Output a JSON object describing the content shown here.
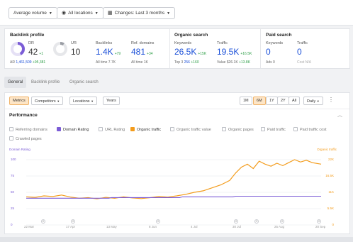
{
  "topbar": {
    "volume": "Average volume",
    "locations": "All locations",
    "changes": "Changes: Last 3 months"
  },
  "backlink": {
    "title": "Backlink profile",
    "dr_label": "DR",
    "dr_value": "42",
    "dr_delta": "+1",
    "ur_label": "UR",
    "ur_value": "10",
    "ar_prefix": "AR",
    "ar_value": "1,461,509",
    "ar_delta": "+95,381",
    "backlinks_label": "Backlinks",
    "backlinks_value": "1.4K",
    "backlinks_delta": "+79",
    "backlinks_sub": "All time 7.7K",
    "refdomains_label": "Ref. domains",
    "refdomains_value": "481",
    "refdomains_delta": "+34",
    "refdomains_sub": "All time 1K"
  },
  "organic": {
    "title": "Organic search",
    "keywords_label": "Keywords",
    "keywords_value": "26.5K",
    "keywords_delta": "+15K",
    "top3_prefix": "Top 3",
    "top3_value": "256",
    "top3_delta": "+160",
    "traffic_label": "Traffic",
    "traffic_value": "19.5K",
    "traffic_delta": "+16.5K",
    "value_prefix": "Value",
    "value_value": "$26.1K",
    "value_delta": "+13.8K"
  },
  "paid": {
    "title": "Paid search",
    "keywords_label": "Keywords",
    "keywords_value": "0",
    "ads_label": "Ads 0",
    "traffic_label": "Traffic",
    "traffic_value": "0",
    "cost_label": "Cost N/A"
  },
  "tabs": [
    "General",
    "Backlink profile",
    "Organic search"
  ],
  "controls": {
    "metrics": "Metrics",
    "competitors": "Competitors",
    "locations": "Locations",
    "years": "Years",
    "ranges": [
      "1M",
      "6M",
      "1Y",
      "2Y",
      "All"
    ],
    "active_range": "6M",
    "interval": "Daily"
  },
  "performance": {
    "title": "Performance",
    "checkboxes": [
      {
        "label": "Referring domains",
        "checked": false
      },
      {
        "label": "Domain Rating",
        "checked": true,
        "color": "#7b5cd6"
      },
      {
        "label": "URL Rating",
        "checked": false
      },
      {
        "label": "Organic traffic",
        "checked": true,
        "color": "#f39c1c"
      },
      {
        "label": "Organic traffic value",
        "checked": false
      },
      {
        "label": "Organic pages",
        "checked": false
      },
      {
        "label": "Paid traffic",
        "checked": false
      },
      {
        "label": "Paid traffic cost",
        "checked": false
      },
      {
        "label": "Crawled pages",
        "checked": false
      }
    ]
  },
  "chart_data": {
    "type": "line",
    "left_axis_title": "Domain Rating",
    "right_axis_title": "Organic traffic",
    "left_ticks": [
      "100",
      "75",
      "50",
      "25",
      "0"
    ],
    "right_ticks": [
      "22K",
      "16.5K",
      "11K",
      "5.5K",
      "0"
    ],
    "x_ticks": [
      "22 Mar",
      "17 Apr",
      "13 May",
      "8 Jun",
      "4 Jul",
      "30 Jul",
      "25 Aug",
      "20 Sep"
    ],
    "markers": [
      "G",
      "G",
      "G",
      "G",
      "G",
      "G",
      "G"
    ],
    "series": [
      {
        "name": "Domain Rating",
        "color": "#7b5cd6",
        "axis": "left",
        "x": [
          0,
          0.28,
          0.29,
          0.52,
          0.53,
          0.7,
          0.71,
          1
        ],
        "values": [
          41,
          41,
          42,
          42,
          43,
          43,
          44,
          44
        ]
      },
      {
        "name": "Organic traffic",
        "color": "#f39c1c",
        "axis": "right",
        "x": [
          0,
          0.03,
          0.06,
          0.09,
          0.12,
          0.15,
          0.18,
          0.21,
          0.24,
          0.27,
          0.3,
          0.33,
          0.36,
          0.39,
          0.42,
          0.45,
          0.48,
          0.51,
          0.54,
          0.57,
          0.6,
          0.63,
          0.66,
          0.69,
          0.71,
          0.73,
          0.75,
          0.77,
          0.79,
          0.81,
          0.83,
          0.85,
          0.87,
          0.89,
          0.91,
          0.93,
          0.95,
          0.97,
          1
        ],
        "values": [
          9500,
          9300,
          9800,
          9600,
          10100,
          9400,
          9000,
          9200,
          8800,
          9300,
          9000,
          9500,
          9100,
          8900,
          9200,
          9600,
          9400,
          9800,
          10300,
          11000,
          11500,
          12500,
          13500,
          15000,
          17500,
          19500,
          20500,
          19000,
          21500,
          20500,
          19800,
          20800,
          20000,
          21000,
          22000,
          21200,
          21800,
          21000,
          20500
        ]
      }
    ]
  }
}
